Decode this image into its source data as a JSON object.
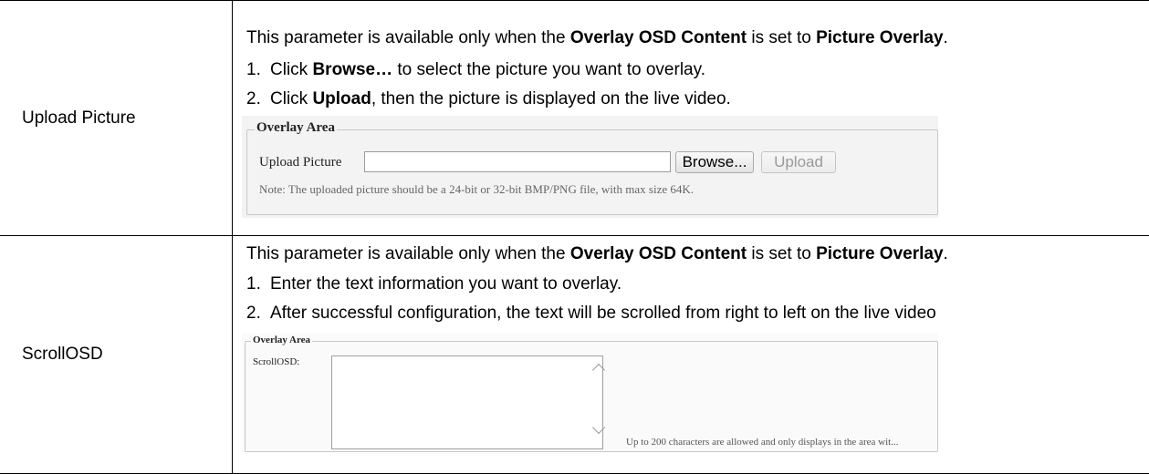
{
  "rows": [
    {
      "name": "Upload Picture",
      "intro_pre": "This parameter is available only when the ",
      "intro_b1": "Overlay OSD Content",
      "intro_mid": " is set to ",
      "intro_b2": "Picture Overlay",
      "intro_end": ".",
      "step1_num": "1.",
      "step1_pre": "Click ",
      "step1_b": "Browse…",
      "step1_post": " to select the picture you want to overlay.",
      "step2_num": "2.",
      "step2_pre": "Click ",
      "step2_b": "Upload",
      "step2_post": ", then the picture is displayed on the live video.",
      "screenshot": {
        "legend": "Overlay Area",
        "field_label": "Upload Picture",
        "input_value": "",
        "browse_label": "Browse...",
        "upload_label": "Upload",
        "note": "Note: The uploaded picture should be a 24-bit or 32-bit BMP/PNG file, with max size 64K."
      }
    },
    {
      "name": "ScrollOSD",
      "intro_pre": "This parameter is available only when the ",
      "intro_b1": "Overlay OSD Content",
      "intro_mid": " is set to ",
      "intro_b2": "Picture Overlay",
      "intro_end": ".",
      "step1_num": "1.",
      "step1_text": "Enter the text information you want to overlay.",
      "step2_num": "2.",
      "step2_text": "After successful configuration, the text will be scrolled from right to left on the live video",
      "screenshot": {
        "legend": "Overlay Area",
        "field_label": "ScrollOSD:",
        "textarea_value": "",
        "hint": "Up to 200 characters are allowed and only displays in the area wit..."
      }
    }
  ]
}
